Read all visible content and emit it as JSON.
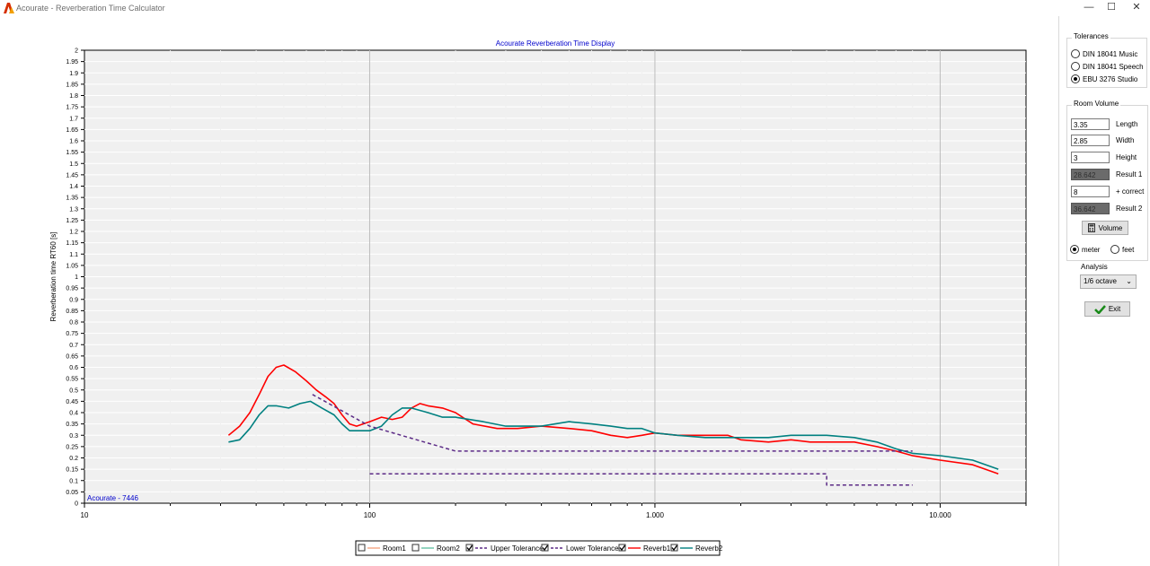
{
  "window": {
    "title": "Acourate - Reverberation Time Calculator",
    "minimize_glyph": "—",
    "maximize_glyph": "☐",
    "close_glyph": "✕"
  },
  "tolerances": {
    "title": "Tolerances",
    "options": [
      {
        "label": "DIN 18041 Music",
        "selected": false
      },
      {
        "label": "DIN 18041 Speech",
        "selected": false
      },
      {
        "label": "EBU 3276 Studio",
        "selected": true
      }
    ]
  },
  "room_volume": {
    "title": "Room Volume",
    "length": {
      "value": "3.35",
      "label": "Length"
    },
    "width": {
      "value": "2.85",
      "label": "Width"
    },
    "height": {
      "value": "3",
      "label": "Height"
    },
    "result1": {
      "value": "28.642",
      "label": "Result 1"
    },
    "correct": {
      "value": "8",
      "label": "+ correct"
    },
    "result2": {
      "value": "36.642",
      "label": "Result 2"
    },
    "volume_button": "Volume",
    "unit_meter": "meter",
    "unit_feet": "feet",
    "unit_selected": "meter"
  },
  "analysis": {
    "label": "Analysis",
    "selected": "1/6 octave"
  },
  "exit_button": "Exit",
  "colors": {
    "room1": "#f4a582",
    "room2": "#66c2a5",
    "reverb1": "#ff0000",
    "reverb2": "#008080",
    "tolerance": "#5b2a86",
    "title_blue": "#0000cc",
    "exit_check": "#1a8a1a"
  },
  "chart_data": {
    "type": "line",
    "title": "Acourate Reverberation Time Display",
    "ylabel": "Reverberation time RT60 [s]",
    "xlabel": "",
    "x_scale": "log",
    "xlim": [
      10,
      20000
    ],
    "ylim": [
      0,
      2
    ],
    "x_ticks": [
      10,
      100,
      1000,
      10000
    ],
    "x_tick_labels": [
      "10",
      "100",
      "1.000",
      "10.000"
    ],
    "y_tick_step": 0.05,
    "grid": true,
    "watermark": "Acourate - 7446",
    "legend_position": "bottom",
    "legend": [
      {
        "name": "Room1",
        "checked": false,
        "style": "solid",
        "color": "#f4a582"
      },
      {
        "name": "Room2",
        "checked": false,
        "style": "solid",
        "color": "#66c2a5"
      },
      {
        "name": "Upper Tolerance",
        "checked": true,
        "style": "dashed",
        "color": "#5b2a86"
      },
      {
        "name": "Lower Tolerance",
        "checked": true,
        "style": "dashed",
        "color": "#5b2a86"
      },
      {
        "name": "Reverb1",
        "checked": true,
        "style": "solid",
        "color": "#ff0000"
      },
      {
        "name": "Reverb2",
        "checked": true,
        "style": "solid",
        "color": "#008080"
      }
    ],
    "series": [
      {
        "name": "Reverb1",
        "color": "#ff0000",
        "points": [
          [
            32,
            0.3
          ],
          [
            35,
            0.34
          ],
          [
            38,
            0.4
          ],
          [
            41,
            0.48
          ],
          [
            44,
            0.56
          ],
          [
            47,
            0.6
          ],
          [
            50,
            0.61
          ],
          [
            55,
            0.58
          ],
          [
            60,
            0.54
          ],
          [
            65,
            0.5
          ],
          [
            70,
            0.47
          ],
          [
            75,
            0.44
          ],
          [
            80,
            0.39
          ],
          [
            85,
            0.35
          ],
          [
            90,
            0.34
          ],
          [
            100,
            0.36
          ],
          [
            110,
            0.38
          ],
          [
            120,
            0.37
          ],
          [
            130,
            0.38
          ],
          [
            140,
            0.42
          ],
          [
            150,
            0.44
          ],
          [
            160,
            0.43
          ],
          [
            180,
            0.42
          ],
          [
            200,
            0.4
          ],
          [
            230,
            0.35
          ],
          [
            280,
            0.33
          ],
          [
            330,
            0.33
          ],
          [
            400,
            0.34
          ],
          [
            500,
            0.33
          ],
          [
            600,
            0.32
          ],
          [
            700,
            0.3
          ],
          [
            800,
            0.29
          ],
          [
            900,
            0.3
          ],
          [
            1000,
            0.31
          ],
          [
            1200,
            0.3
          ],
          [
            1500,
            0.3
          ],
          [
            1800,
            0.3
          ],
          [
            2000,
            0.28
          ],
          [
            2500,
            0.27
          ],
          [
            3000,
            0.28
          ],
          [
            3500,
            0.27
          ],
          [
            4000,
            0.27
          ],
          [
            5000,
            0.27
          ],
          [
            6000,
            0.25
          ],
          [
            7000,
            0.23
          ],
          [
            8000,
            0.21
          ],
          [
            10000,
            0.19
          ],
          [
            13000,
            0.17
          ],
          [
            16000,
            0.13
          ]
        ]
      },
      {
        "name": "Reverb2",
        "color": "#008080",
        "points": [
          [
            32,
            0.27
          ],
          [
            35,
            0.28
          ],
          [
            38,
            0.33
          ],
          [
            41,
            0.39
          ],
          [
            44,
            0.43
          ],
          [
            47,
            0.43
          ],
          [
            52,
            0.42
          ],
          [
            57,
            0.44
          ],
          [
            62,
            0.45
          ],
          [
            68,
            0.42
          ],
          [
            75,
            0.39
          ],
          [
            80,
            0.35
          ],
          [
            85,
            0.32
          ],
          [
            90,
            0.32
          ],
          [
            100,
            0.32
          ],
          [
            110,
            0.34
          ],
          [
            120,
            0.39
          ],
          [
            130,
            0.42
          ],
          [
            140,
            0.42
          ],
          [
            160,
            0.4
          ],
          [
            180,
            0.38
          ],
          [
            200,
            0.38
          ],
          [
            250,
            0.36
          ],
          [
            300,
            0.34
          ],
          [
            400,
            0.34
          ],
          [
            500,
            0.36
          ],
          [
            600,
            0.35
          ],
          [
            700,
            0.34
          ],
          [
            800,
            0.33
          ],
          [
            900,
            0.33
          ],
          [
            1000,
            0.31
          ],
          [
            1200,
            0.3
          ],
          [
            1500,
            0.29
          ],
          [
            2000,
            0.29
          ],
          [
            2500,
            0.29
          ],
          [
            3000,
            0.3
          ],
          [
            3500,
            0.3
          ],
          [
            4000,
            0.3
          ],
          [
            5000,
            0.29
          ],
          [
            6000,
            0.27
          ],
          [
            7000,
            0.24
          ],
          [
            8000,
            0.22
          ],
          [
            10000,
            0.21
          ],
          [
            13000,
            0.19
          ],
          [
            16000,
            0.15
          ]
        ]
      },
      {
        "name": "Upper Tolerance",
        "color": "#5b2a86",
        "dashed": true,
        "points": [
          [
            63,
            0.48
          ],
          [
            100,
            0.34
          ],
          [
            200,
            0.23
          ],
          [
            8000,
            0.23
          ]
        ]
      },
      {
        "name": "Lower Tolerance",
        "color": "#5b2a86",
        "dashed": true,
        "points": [
          [
            100,
            0.13
          ],
          [
            4000,
            0.13
          ],
          [
            4000,
            0.08
          ],
          [
            8000,
            0.08
          ]
        ]
      }
    ]
  }
}
